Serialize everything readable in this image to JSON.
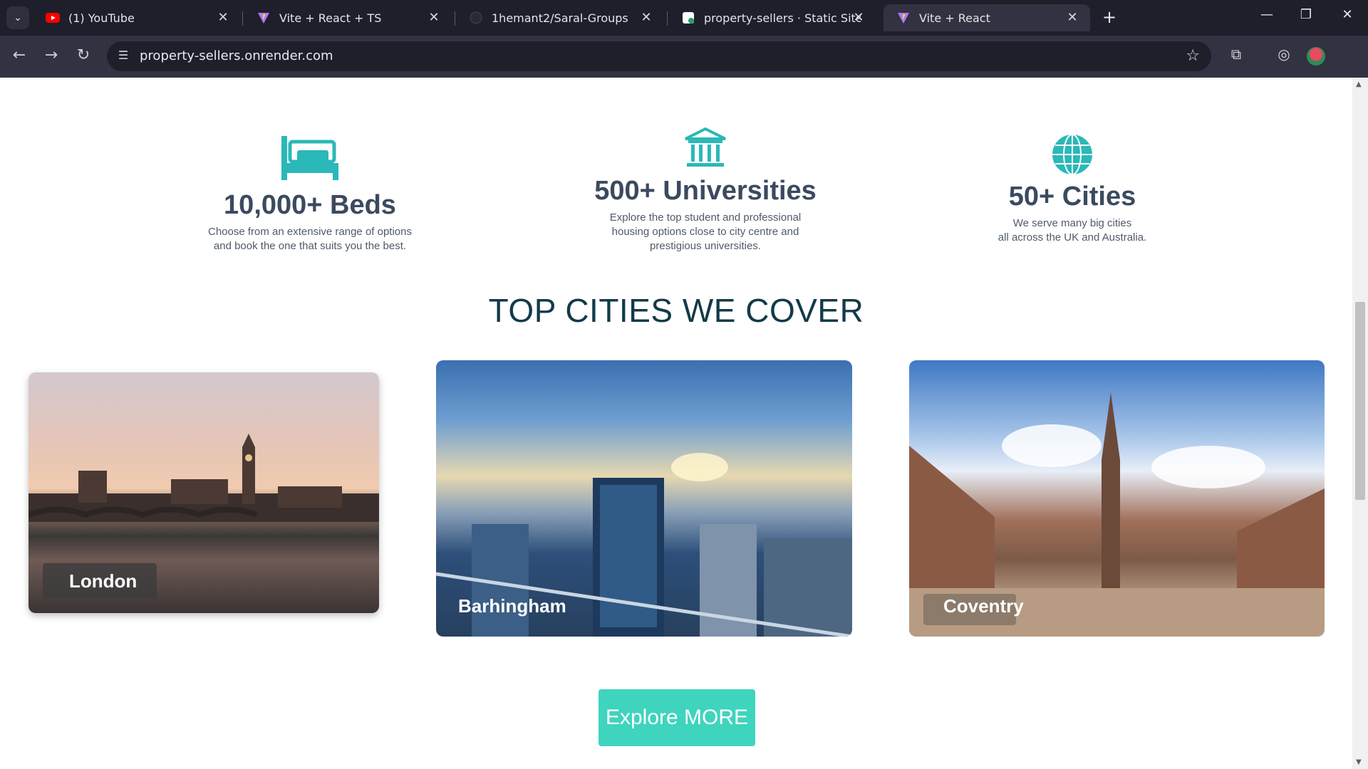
{
  "browser": {
    "tabs": [
      {
        "title": "(1) YouTube",
        "icon": "youtube-icon"
      },
      {
        "title": "Vite + React + TS",
        "icon": "vite-icon"
      },
      {
        "title": "1hemant2/Saral-Groups",
        "icon": "github-icon"
      },
      {
        "title": "property-sellers · Static Site · R",
        "icon": "render-icon"
      },
      {
        "title": "Vite + React",
        "icon": "vite-icon",
        "active": true
      }
    ],
    "url": "property-sellers.onrender.com"
  },
  "features": [
    {
      "number": "10,000+ Beds",
      "description": "Choose from an extensive range of options\nand book the one that suits you the best.",
      "icon": "bed-icon"
    },
    {
      "number": "500+ Universities",
      "description": "Explore the top student and professional\nhousing options close to city centre and\nprestigious universities.",
      "icon": "university-icon"
    },
    {
      "number": "50+ Cities",
      "description": "We serve many big cities\nall across the UK and Australia.",
      "icon": "globe-icon"
    }
  ],
  "section_title": "TOP CITIES WE COVER",
  "cities": [
    {
      "name": "London"
    },
    {
      "name": "Barhingham"
    },
    {
      "name": "Coventry"
    }
  ],
  "explore_button": "Explore MORE",
  "colors": {
    "accent": "#3fd4be",
    "icon_teal": "#2bb8b8",
    "heading": "#123a4a"
  }
}
